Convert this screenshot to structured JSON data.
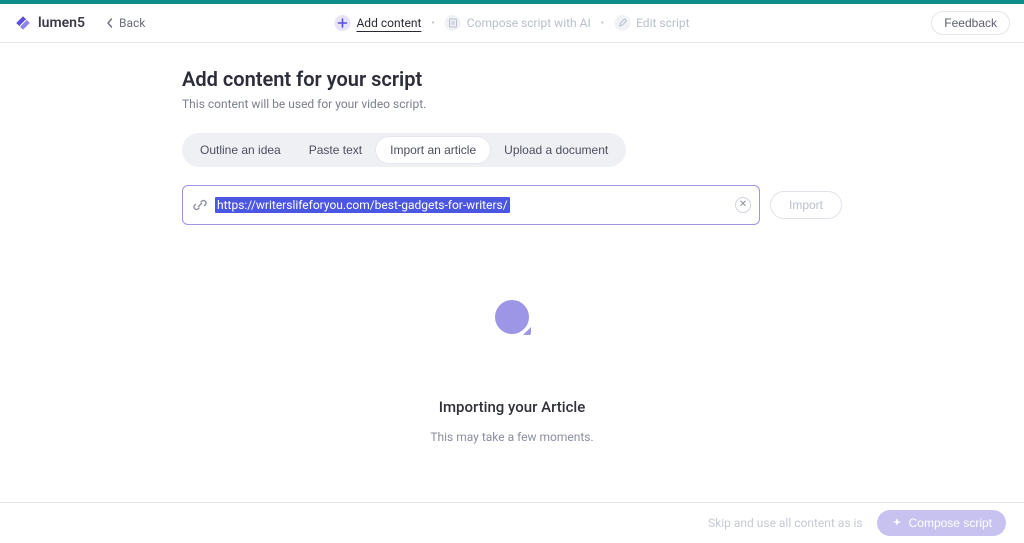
{
  "brand": {
    "name": "lumen5"
  },
  "header": {
    "back_label": "Back",
    "steps": [
      {
        "label": "Add content",
        "active": true,
        "icon": "plus"
      },
      {
        "label": "Compose script with AI",
        "active": false,
        "icon": "doc"
      },
      {
        "label": "Edit script",
        "active": false,
        "icon": "pencil"
      }
    ],
    "feedback_label": "Feedback"
  },
  "page": {
    "title": "Add content for your script",
    "subtitle": "This content will be used for your video script.",
    "tabs": [
      {
        "label": "Outline an idea",
        "active": false
      },
      {
        "label": "Paste text",
        "active": false
      },
      {
        "label": "Import an article",
        "active": true
      },
      {
        "label": "Upload a document",
        "active": false
      }
    ],
    "url_value": "https://writerslifeforyou.com/best-gadgets-for-writers/",
    "import_label": "Import"
  },
  "loading": {
    "title": "Importing your Article",
    "subtitle": "This may take a few moments."
  },
  "footer": {
    "skip_label": "Skip and use all content as is",
    "compose_label": "Compose script"
  }
}
